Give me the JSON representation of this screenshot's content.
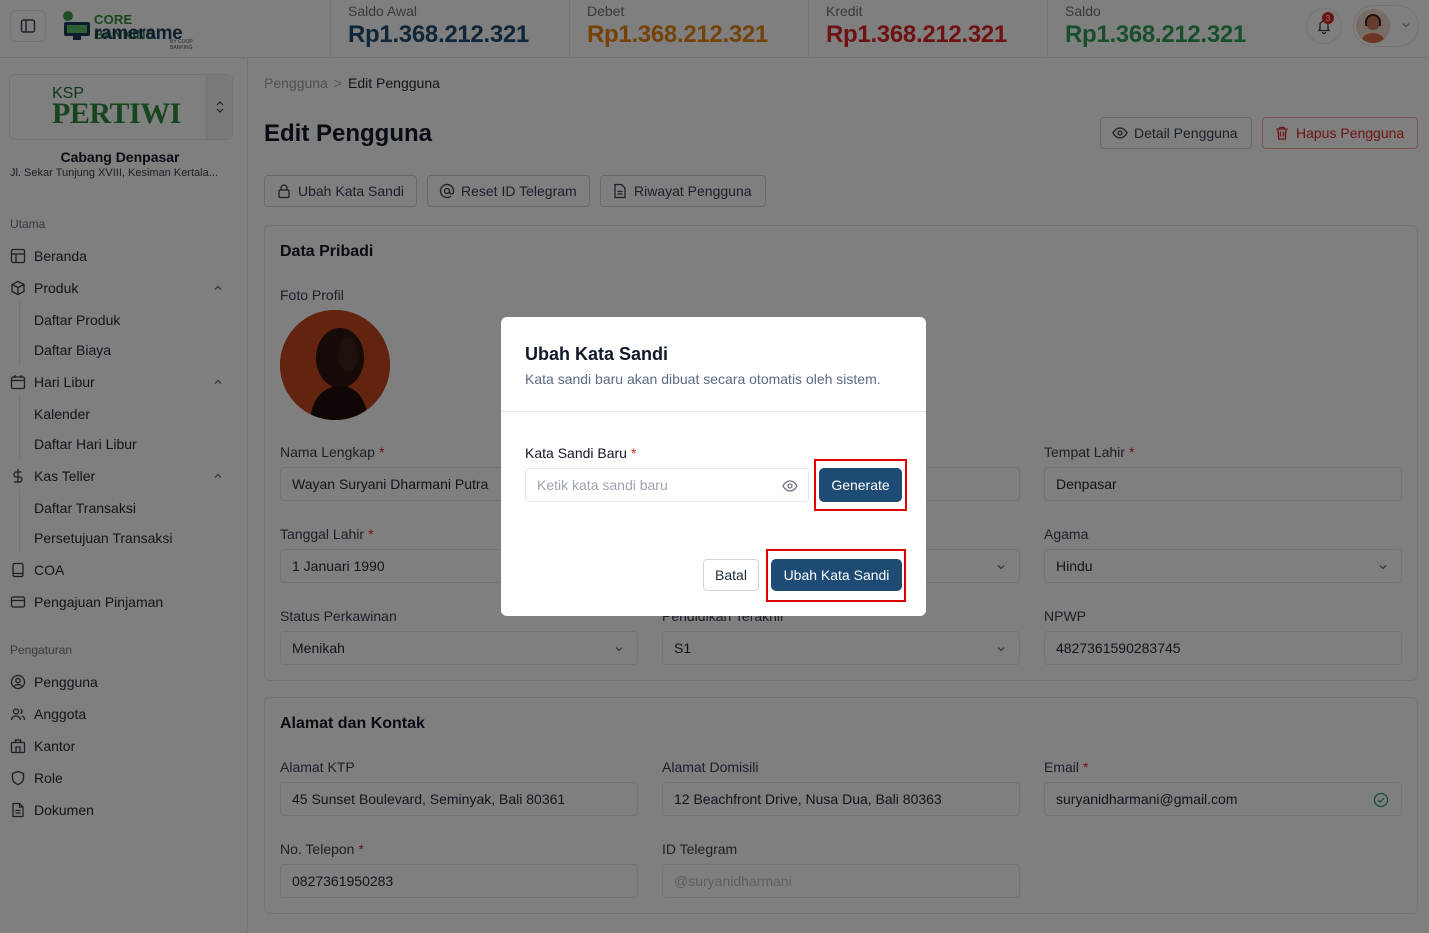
{
  "header": {
    "logo_line1": "CORE BANKING",
    "logo_line2": "ramerame",
    "logo_line3": "BY COOP BANKING",
    "stats": [
      {
        "label": "Saldo Awal",
        "value": "Rp1.368.212.321",
        "color": "#1e4b73"
      },
      {
        "label": "Debet",
        "value": "Rp1.368.212.321",
        "color": "#e8850f"
      },
      {
        "label": "Kredit",
        "value": "Rp1.368.212.321",
        "color": "#dc2626"
      },
      {
        "label": "Saldo",
        "value": "Rp1.368.212.321",
        "color": "#2e9f5a"
      }
    ],
    "notif_count": "3"
  },
  "sidebar": {
    "org_ksp": "KSP",
    "org_name": "PERTIWI",
    "branch": "Cabang Denpasar",
    "address": "Jl. Sekar Tunjung XVIII, Kesiman Kertala...",
    "section_main": "Utama",
    "section_settings": "Pengaturan",
    "items": {
      "beranda": "Beranda",
      "produk": "Produk",
      "daftar_produk": "Daftar Produk",
      "daftar_biaya": "Daftar Biaya",
      "hari_libur": "Hari Libur",
      "kalender": "Kalender",
      "daftar_hari_libur": "Daftar Hari Libur",
      "kas_teller": "Kas Teller",
      "daftar_transaksi": "Daftar Transaksi",
      "persetujuan_transaksi": "Persetujuan Transaksi",
      "coa": "COA",
      "pengajuan_pinjaman": "Pengajuan Pinjaman",
      "pengguna": "Pengguna",
      "anggota": "Anggota",
      "kantor": "Kantor",
      "role": "Role",
      "dokumen": "Dokumen"
    }
  },
  "main": {
    "breadcrumb_root": "Pengguna",
    "breadcrumb_sep": ">",
    "breadcrumb_current": "Edit Pengguna",
    "title": "Edit Pengguna",
    "detail_button": "Detail Pengguna",
    "delete_button": "Hapus Pengguna",
    "tabs": {
      "ubah_kata_sandi": "Ubah Kata Sandi",
      "reset_telegram": "Reset ID Telegram",
      "riwayat": "Riwayat Pengguna"
    },
    "personal": {
      "title": "Data Pribadi",
      "foto_label": "Foto Profil",
      "nama_label": "Nama Lengkap",
      "nama_value": "Wayan Suryani Dharmani Putra",
      "tempat_label": "Tempat Lahir",
      "tempat_value": "Denpasar",
      "tanggal_label": "Tanggal Lahir",
      "tanggal_value": "1 Januari 1990",
      "agama_label": "Agama",
      "agama_value": "Hindu",
      "status_label": "Status Perkawinan",
      "status_value": "Menikah",
      "pendidikan_label": "Pendidikan Terakhir",
      "pendidikan_value": "S1",
      "npwp_label": "NPWP",
      "npwp_value": "4827361590283745"
    },
    "contact": {
      "title": "Alamat dan Kontak",
      "ktp_label": "Alamat KTP",
      "ktp_value": "45 Sunset Boulevard, Seminyak, Bali 80361",
      "domisili_label": "Alamat Domisili",
      "domisili_value": "12 Beachfront Drive, Nusa Dua, Bali 80363",
      "email_label": "Email",
      "email_value": "suryanidharmani@gmail.com",
      "telepon_label": "No. Telepon",
      "telepon_value": "0827361950283",
      "telegram_label": "ID Telegram",
      "telegram_placeholder": "@suryanidharmani"
    }
  },
  "modal": {
    "title": "Ubah Kata Sandi",
    "description": "Kata sandi baru akan dibuat secara otomatis oleh sistem.",
    "field_label": "Kata Sandi Baru",
    "field_placeholder": "Ketik kata sandi baru",
    "generate_button": "Generate",
    "cancel_button": "Batal",
    "submit_button": "Ubah Kata Sandi",
    "highlight_color": "#e00000"
  }
}
